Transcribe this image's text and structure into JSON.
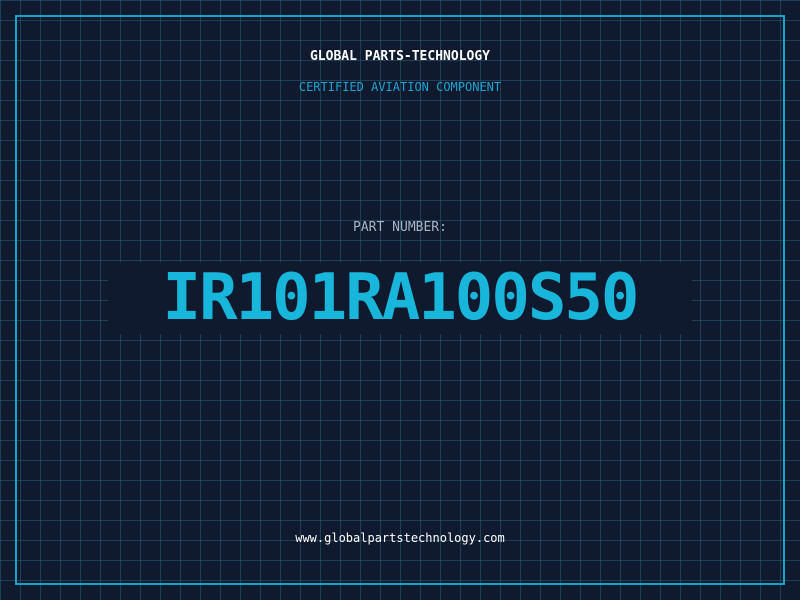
{
  "header": {
    "company": "GLOBAL PARTS-TECHNOLOGY",
    "tagline": "CERTIFIED AVIATION COMPONENT"
  },
  "part": {
    "label": "PART NUMBER:",
    "number": "IR101RA100S50"
  },
  "footer": {
    "url": "www.globalpartstechnology.com"
  },
  "colors": {
    "background": "#101a2e",
    "grid": "#286e8c",
    "frame": "#19a3c9",
    "accent": "#19b6dc",
    "tagline": "#1fa3d1",
    "label": "#a8b4c4"
  }
}
